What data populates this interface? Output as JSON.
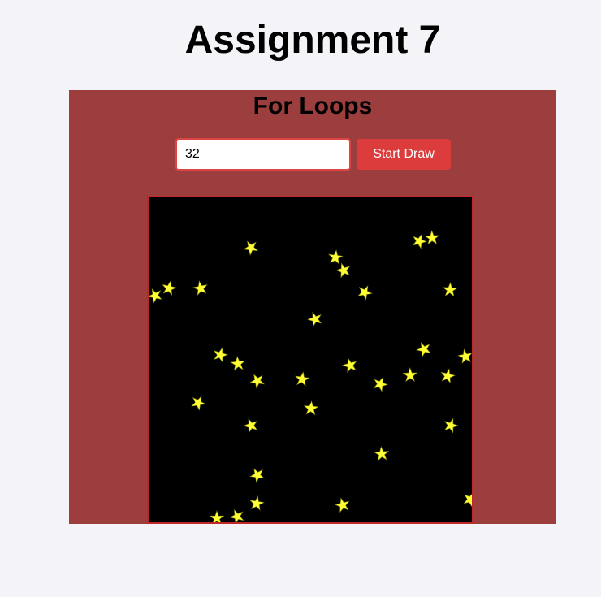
{
  "page": {
    "title": "Assignment 7"
  },
  "section": {
    "title": "For Loops"
  },
  "controls": {
    "input_value": "32",
    "button_label": "Start Draw"
  },
  "canvas": {
    "background_color": "#000000",
    "star_color": "#ffff33",
    "star_count_drawn": 32
  }
}
